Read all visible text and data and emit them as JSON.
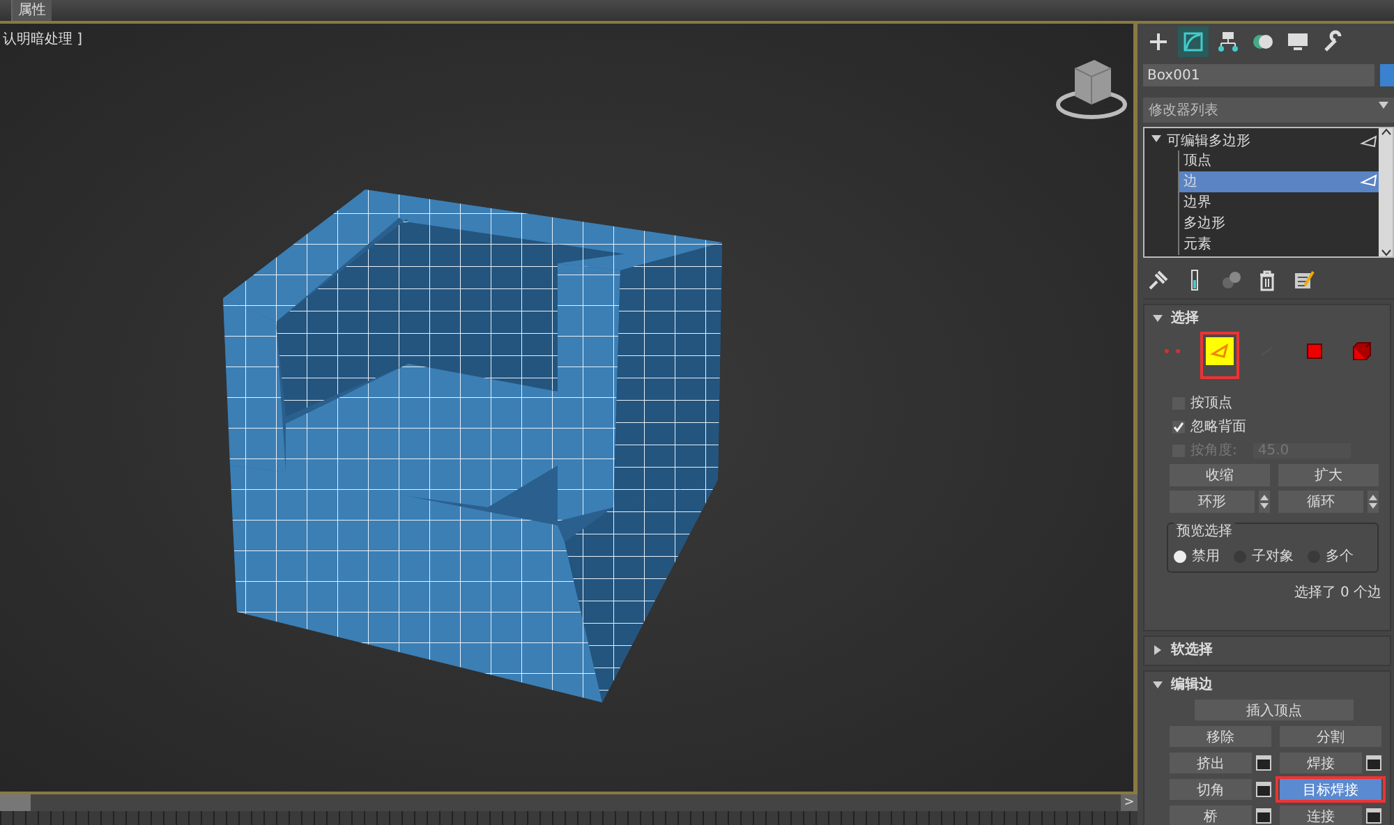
{
  "menu_tabs": [
    {
      "label": "属性"
    }
  ],
  "viewport": {
    "label": "认明暗处理 ]"
  },
  "command_panel": {
    "tabs": [
      {
        "kind": "create",
        "selected": false
      },
      {
        "kind": "modify",
        "selected": true
      },
      {
        "kind": "hierarchy",
        "selected": false
      },
      {
        "kind": "motion",
        "selected": false
      },
      {
        "kind": "display",
        "selected": false
      },
      {
        "kind": "utilities",
        "selected": false
      }
    ],
    "object_name": "Box001",
    "modifier_list": "修改器列表",
    "stack": [
      {
        "label": "可编辑多边形",
        "expanded": true,
        "children": [
          {
            "label": "顶点",
            "selected": false
          },
          {
            "label": "边",
            "selected": true
          },
          {
            "label": "边界",
            "selected": false
          },
          {
            "label": "多边形",
            "selected": false
          },
          {
            "label": "元素",
            "selected": false
          }
        ]
      }
    ],
    "stack_tools": [
      {
        "kind": "pin"
      },
      {
        "kind": "show-result"
      },
      {
        "kind": "make-unique"
      },
      {
        "kind": "remove"
      },
      {
        "kind": "configure"
      }
    ]
  },
  "selection_rollout": {
    "title": "选择",
    "expanded": true,
    "subobjects": [
      {
        "kind": "vertex",
        "selected": false
      },
      {
        "kind": "edge",
        "selected": true
      },
      {
        "kind": "border",
        "selected": false
      },
      {
        "kind": "polygon",
        "selected": false
      },
      {
        "kind": "element",
        "selected": false
      }
    ],
    "by_vertex": {
      "label": "按顶点",
      "checked": false
    },
    "ignore_backfacing": {
      "label": "忽略背面",
      "checked": true
    },
    "by_angle": {
      "label": "按角度:",
      "checked": false,
      "disabled": true,
      "value": "45.0"
    },
    "buttons": [
      {
        "label": "收缩",
        "spinner": false
      },
      {
        "label": "扩大",
        "spinner": false
      },
      {
        "label": "环形",
        "spinner": true
      },
      {
        "label": "循环",
        "spinner": true
      }
    ],
    "preview": {
      "title": "预览选择",
      "options": [
        {
          "label": "禁用",
          "selected": true
        },
        {
          "label": "子对象",
          "selected": false
        },
        {
          "label": "多个",
          "selected": false
        }
      ]
    },
    "status": "选择了 0 个边"
  },
  "soft_selection_rollout": {
    "title": "软选择",
    "expanded": false
  },
  "edit_edges_rollout": {
    "title": "编辑边",
    "expanded": true,
    "insert_vertex": {
      "label": "插入顶点",
      "settings": false,
      "selected": false
    },
    "rows": [
      [
        {
          "label": "移除",
          "settings": false,
          "selected": false
        },
        {
          "label": "分割",
          "settings": false,
          "selected": false
        }
      ],
      [
        {
          "label": "挤出",
          "settings": true,
          "selected": false
        },
        {
          "label": "焊接",
          "settings": true,
          "selected": false
        }
      ],
      [
        {
          "label": "切角",
          "settings": true,
          "selected": false
        },
        {
          "label": "目标焊接",
          "settings": false,
          "selected": true
        }
      ],
      [
        {
          "label": "桥",
          "settings": true,
          "selected": false
        },
        {
          "label": "连接",
          "settings": true,
          "selected": false
        }
      ]
    ]
  },
  "timeline": {
    "next_button": ">",
    "level": 0
  }
}
